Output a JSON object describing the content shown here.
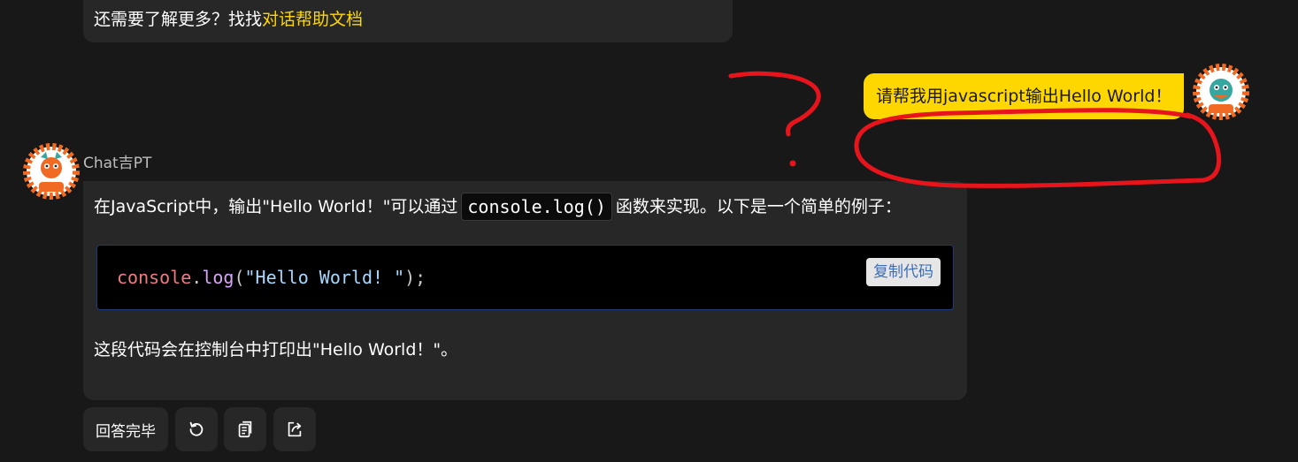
{
  "previous_message": {
    "text": "还需要了解更多？找找",
    "link_label": "对话帮助文档"
  },
  "user_message": {
    "text": "请帮我用javascript输出Hello World！"
  },
  "bot": {
    "name": "Chat吉PT",
    "intro_before": "在JavaScript中，输出\"Hello World！\"可以通过",
    "inline_code": "console.log()",
    "intro_after": "函数来实现。以下是一个简单的例子：",
    "code": {
      "object": "console",
      "dot": ".",
      "method": "log",
      "open": "(",
      "string": "\"Hello World! \"",
      "close": ");"
    },
    "copy_label": "复制代码",
    "outro": "这段代码会在控制台中打印出\"Hello World！\"。"
  },
  "actions": {
    "done_label": "回答完毕",
    "regenerate_icon": "refresh-icon",
    "copy_icon": "copy-icon",
    "share_icon": "share-icon"
  },
  "colors": {
    "accent": "#ffd700",
    "background": "#181818",
    "bubble": "#272727",
    "annotation": "#e8141c"
  }
}
